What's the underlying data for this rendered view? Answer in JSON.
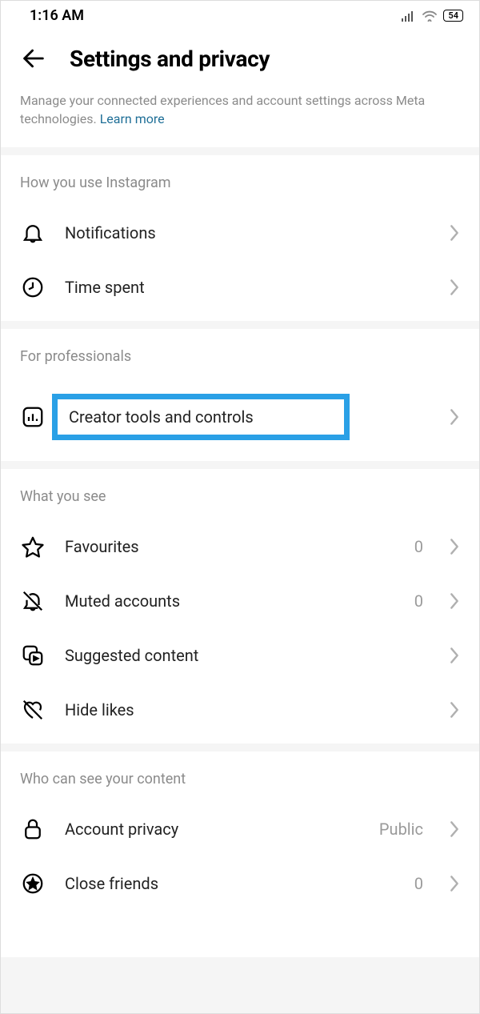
{
  "status": {
    "time": "1:16 AM",
    "battery": "54"
  },
  "header": {
    "title": "Settings and privacy"
  },
  "description": {
    "text": "Manage your connected experiences and account settings across Meta technologies. ",
    "link": "Learn more"
  },
  "sections": {
    "usage": {
      "title": "How you use Instagram",
      "notifications": "Notifications",
      "time_spent": "Time spent"
    },
    "professionals": {
      "title": "For professionals",
      "creator_tools": "Creator tools and controls"
    },
    "what_you_see": {
      "title": "What you see",
      "favourites": "Favourites",
      "favourites_count": "0",
      "muted": "Muted accounts",
      "muted_count": "0",
      "suggested": "Suggested content",
      "hide_likes": "Hide likes"
    },
    "who_sees": {
      "title": "Who can see your content",
      "account_privacy": "Account privacy",
      "account_privacy_value": "Public",
      "close_friends": "Close friends",
      "close_friends_count": "0"
    }
  }
}
